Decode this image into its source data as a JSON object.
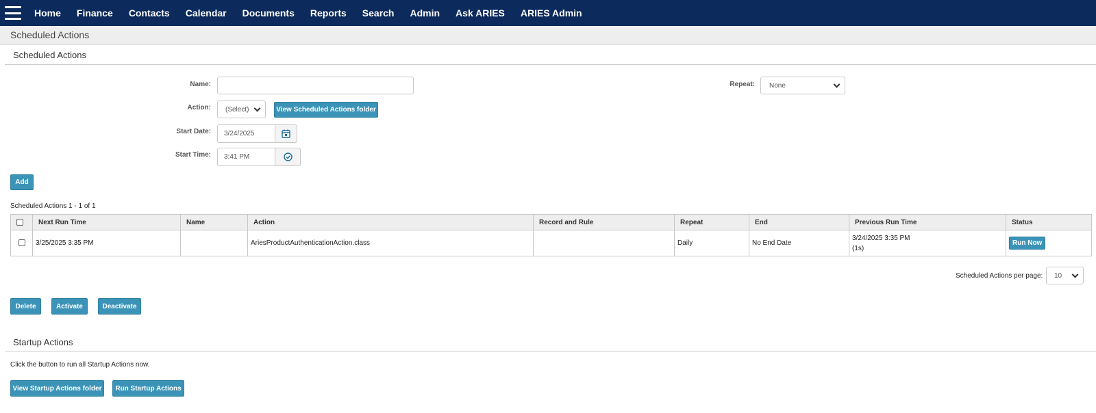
{
  "nav": {
    "menu_icon": "hamburger-menu-icon",
    "items": [
      "Home",
      "Finance",
      "Contacts",
      "Calendar",
      "Documents",
      "Reports",
      "Search",
      "Admin",
      "Ask ARIES",
      "ARIES Admin"
    ]
  },
  "page": {
    "title": "Scheduled Actions"
  },
  "form": {
    "heading": "Scheduled Actions",
    "name_label": "Name:",
    "name_value": "",
    "action_label": "Action:",
    "action_value": "(Select)",
    "view_folder_button": "View Scheduled Actions folder",
    "start_date_label": "Start Date:",
    "start_date_value": "3/24/2025",
    "calendar_icon": "calendar-icon",
    "start_time_label": "Start Time:",
    "start_time_value": "3:41 PM",
    "clock_icon": "clock-check-icon",
    "repeat_label": "Repeat:",
    "repeat_value": "None",
    "add_button": "Add"
  },
  "table": {
    "count_label": "Scheduled Actions 1 - 1 of 1",
    "headers": [
      "Next Run Time",
      "Name",
      "Action",
      "Record and Rule",
      "Repeat",
      "End",
      "Previous Run Time",
      "Status"
    ],
    "rows": [
      {
        "next_run": "3/25/2025 3:35 PM",
        "name": "",
        "action": "AriesProductAuthenticationAction.class",
        "record_rule": "",
        "repeat": "Daily",
        "end": "No End Date",
        "prev_run": "3/24/2025 3:35 PM",
        "prev_run_duration": "(1s)",
        "status_button": "Run Now"
      }
    ],
    "per_page_label": "Scheduled Actions per page:",
    "per_page_value": "10"
  },
  "bulk_actions": {
    "delete": "Delete",
    "activate": "Activate",
    "deactivate": "Deactivate"
  },
  "startup": {
    "heading": "Startup Actions",
    "description": "Click the button to run all Startup Actions now.",
    "view_folder_button": "View Startup Actions folder",
    "run_button": "Run Startup Actions"
  },
  "colors": {
    "nav_bg": "#0c2a5b",
    "button": "#3b94b8",
    "header_bg": "#eeeeee",
    "icon_accent": "#1f6f9a"
  }
}
